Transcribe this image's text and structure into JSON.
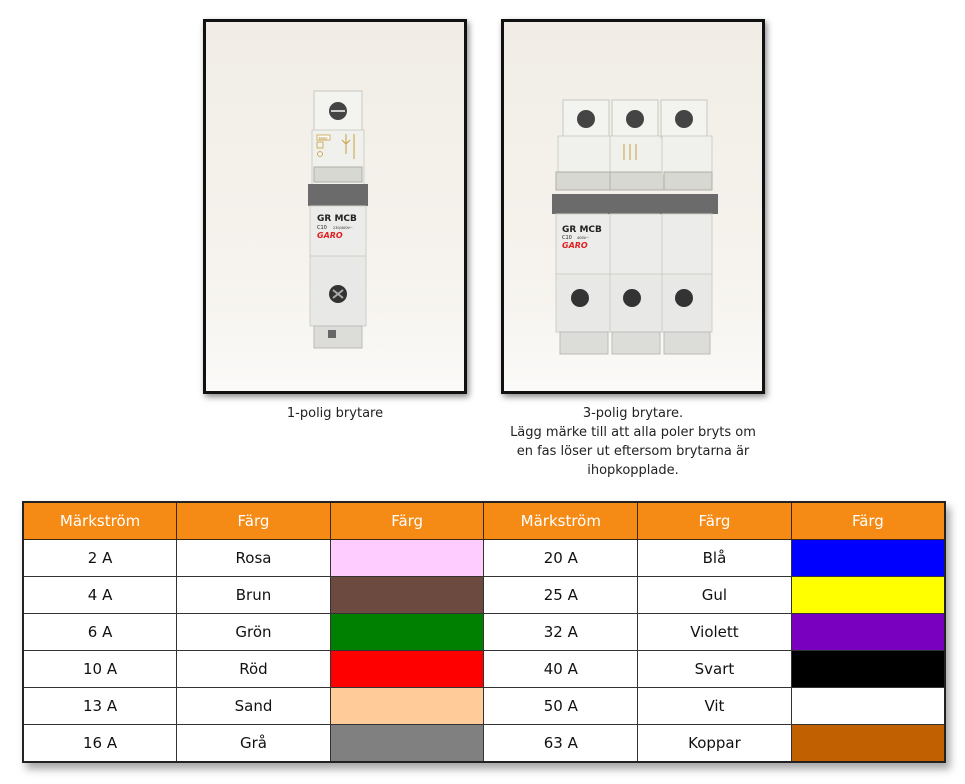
{
  "captions": {
    "single_pole": "1-polig brytare",
    "three_pole": [
      "3-polig brytare.",
      "Lägg märke till att alla poler bryts om",
      "en fas löser ut eftersom brytarna är",
      "ihopkopplade."
    ]
  },
  "breaker_label": {
    "model": "GR MCB",
    "rating": "C10",
    "brand": "GARO",
    "voltage_single": "230/400V~",
    "voltage_three": "400V~",
    "code": "6000",
    "class": "3"
  },
  "table": {
    "headers": [
      "Märkström",
      "Färg",
      "Färg",
      "Märkström",
      "Färg",
      "Färg"
    ],
    "rows": [
      {
        "left_current": "2 A",
        "left_name": "Rosa",
        "left_color": "#ffccff",
        "right_current": "20 A",
        "right_name": "Blå",
        "right_color": "#0000ff"
      },
      {
        "left_current": "4 A",
        "left_name": "Brun",
        "left_color": "#6d4a40",
        "right_current": "25 A",
        "right_name": "Gul",
        "right_color": "#ffff00"
      },
      {
        "left_current": "6 A",
        "left_name": "Grön",
        "left_color": "#008000",
        "right_current": "32 A",
        "right_name": "Violett",
        "right_color": "#7a00c0"
      },
      {
        "left_current": "10 A",
        "left_name": "Röd",
        "left_color": "#ff0000",
        "right_current": "40 A",
        "right_name": "Svart",
        "right_color": "#000000"
      },
      {
        "left_current": "13 A",
        "left_name": "Sand",
        "left_color": "#ffcc99",
        "right_current": "50 A",
        "right_name": "Vit",
        "right_color": "#ffffff"
      },
      {
        "left_current": "16 A",
        "left_name": "Grå",
        "left_color": "#808080",
        "right_current": "63 A",
        "right_name": "Koppar",
        "right_color": "#c06000"
      }
    ]
  }
}
